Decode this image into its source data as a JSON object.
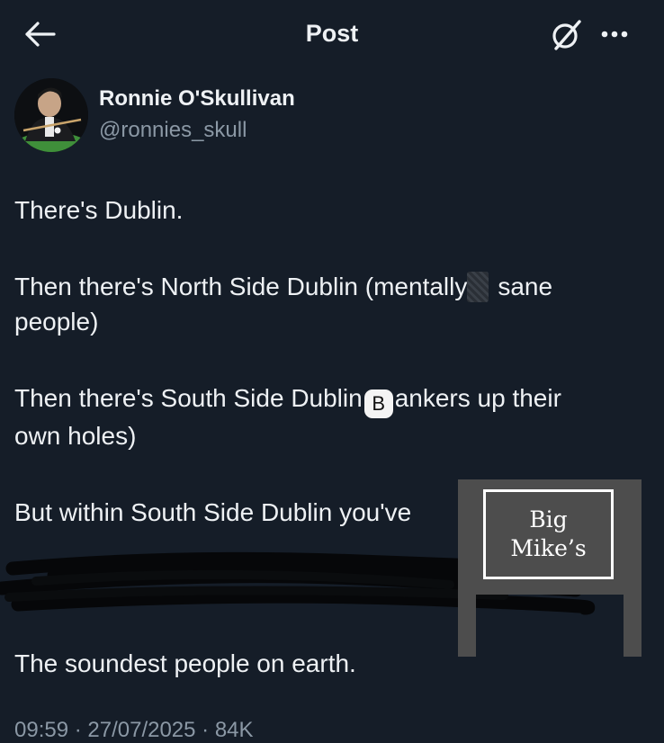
{
  "header": {
    "title": "Post"
  },
  "author": {
    "display_name": "Ronnie O'Skullivan",
    "handle": "@ronnies_skull"
  },
  "post": {
    "line1": "There's Dublin.",
    "line2_start": "Then there's North Side Dublin (mentally",
    "line2_end": "sane",
    "line2_cont": "people)",
    "line3_start": "Then there's South Side Dublin",
    "line3_badge": "B",
    "line3_end": "ankers up their",
    "line3_cont": "own holes)",
    "line4": "But within South Side Dublin you've",
    "line5": "The soundest people on earth."
  },
  "sign": {
    "line1": "Big",
    "line2": "Mike’s"
  },
  "footer": {
    "timestamp": "09:59 · 27/07/2025 · 84K"
  },
  "colors": {
    "background": "#151d28",
    "text": "#eef1f4",
    "secondary_text": "#8b98a5"
  },
  "icons": {
    "back": "back-arrow-icon",
    "grok": "grok-icon",
    "more": "more-dots-icon"
  }
}
